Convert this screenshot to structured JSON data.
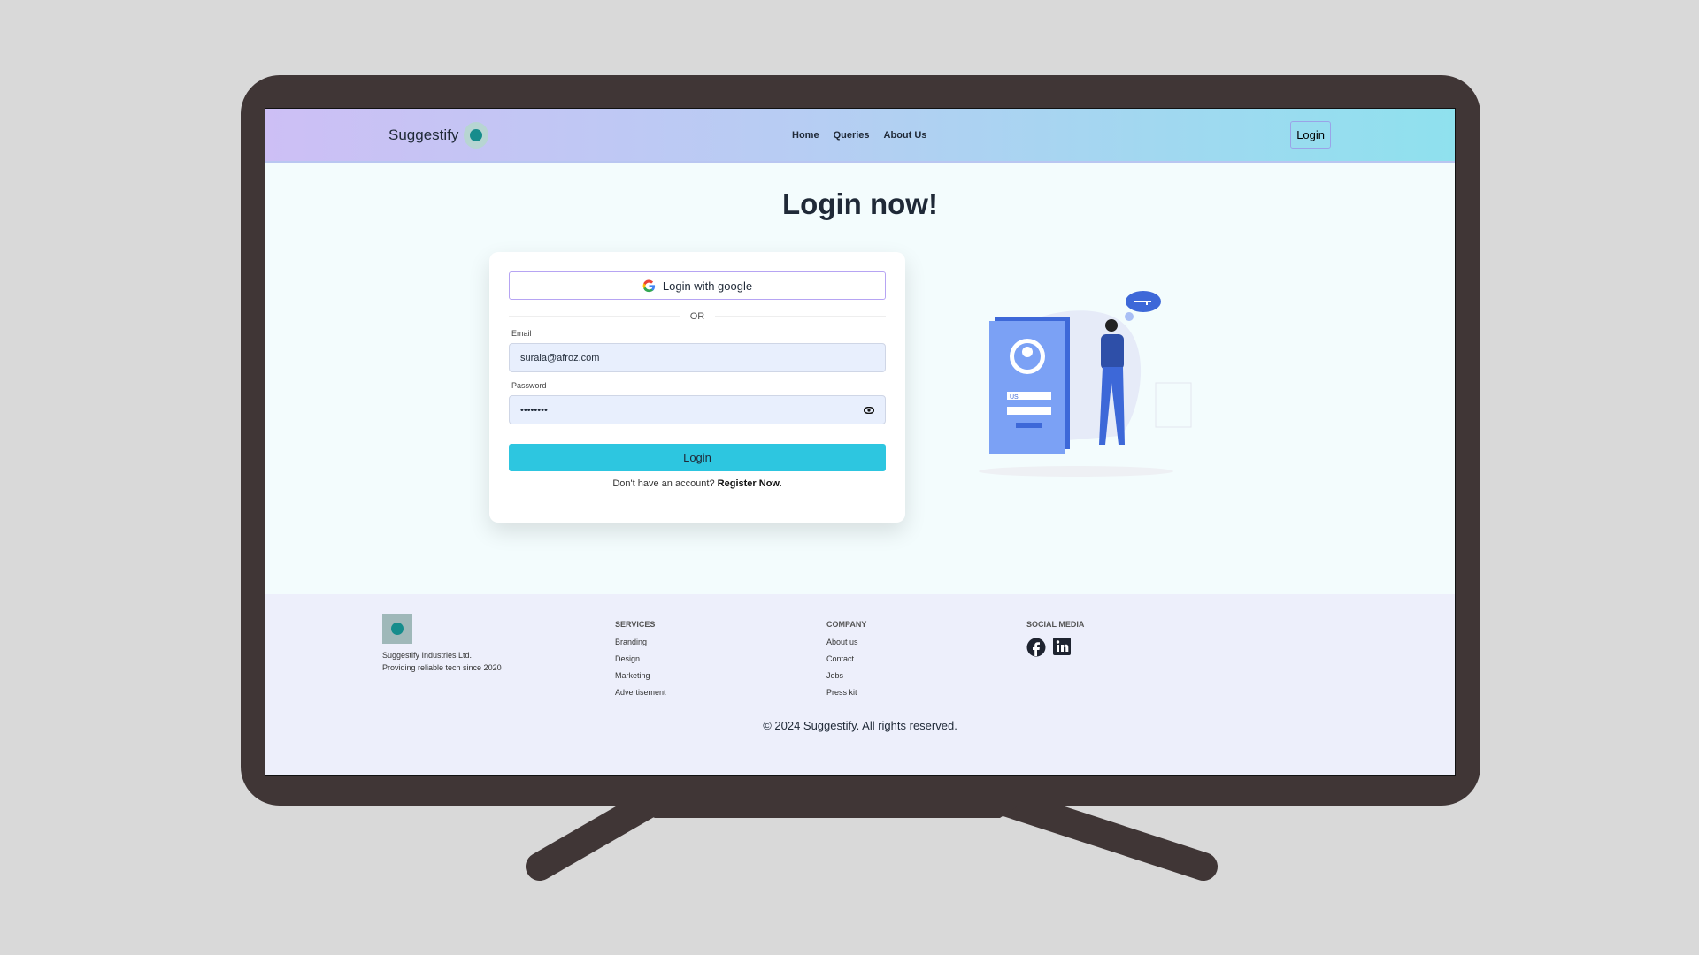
{
  "nav": {
    "brand": "Suggestify",
    "links": [
      "Home",
      "Queries",
      "About Us"
    ],
    "login": "Login"
  },
  "main": {
    "title": "Login now!",
    "google_label": "Login with google",
    "or": "OR",
    "email_label": "Email",
    "email_value": "suraia@afroz.com",
    "password_label": "Password",
    "password_value": "••••••••",
    "login_label": "Login",
    "register_prompt": "Don't have an account?",
    "register_link": "Register Now."
  },
  "illustration": {
    "card_text": "US"
  },
  "footer": {
    "company_name": "Suggestify Industries Ltd.",
    "tagline": "Providing reliable tech since 2020",
    "services": {
      "title": "SERVICES",
      "items": [
        "Branding",
        "Design",
        "Marketing",
        "Advertisement"
      ]
    },
    "company": {
      "title": "COMPANY",
      "items": [
        "About us",
        "Contact",
        "Jobs",
        "Press kit"
      ]
    },
    "social": {
      "title": "SOCIAL MEDIA",
      "icons": [
        "facebook-icon",
        "linkedin-icon"
      ]
    },
    "copyright": "© 2024 Suggestify. All rights reserved."
  },
  "colors": {
    "accent": "#2dc6e0",
    "bezel": "#403636"
  }
}
